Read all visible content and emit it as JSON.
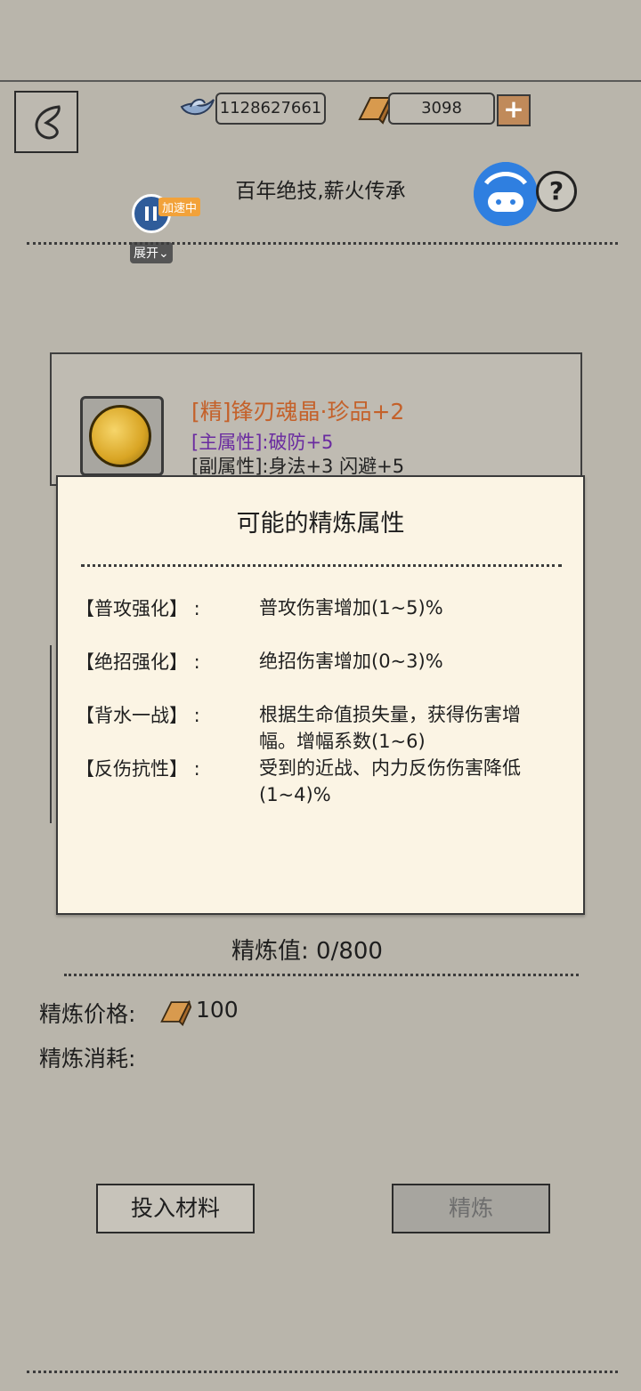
{
  "header": {
    "silver_amount": "1128627661",
    "gold_amount": "3098",
    "title": "百年绝技,薪火传承"
  },
  "overlay": {
    "accelerating_label": "加速中",
    "expand_label": "展开"
  },
  "item": {
    "name": "[精]锋刃魂晶·珍品+2",
    "main_attr": "[主属性]:破防+5",
    "sub_attr": "[副属性]:身法+3 闪避+5"
  },
  "popup": {
    "title": "可能的精炼属性",
    "attributes": [
      {
        "key": "【普攻强化】 :",
        "desc": "普攻伤害增加(1~5)%"
      },
      {
        "key": "【绝招强化】 :",
        "desc": "绝招伤害增加(0~3)%"
      },
      {
        "key": "【背水一战】 :",
        "desc": "根据生命值损失量，获得伤害增幅。增幅系数(1~6)"
      },
      {
        "key": "【反伤抗性】 :",
        "desc": "受到的近战、内力反伤伤害降低(1~4)%"
      }
    ]
  },
  "refine": {
    "value_label": "精炼值: 0/800",
    "price_label": "精炼价格:",
    "price_value": "100",
    "cost_label": "精炼消耗:"
  },
  "buttons": {
    "input_material": "投入材料",
    "refine": "精炼"
  },
  "colors": {
    "background": "#b9b5ab",
    "popup_bg": "#fbf4e4",
    "item_name": "#c4612a",
    "main_attr": "#6a2ba0",
    "plus_button": "#c08a5a"
  },
  "icons": [
    "back-icon",
    "silver-ingot-icon",
    "gold-bar-icon",
    "plus-icon",
    "help-icon",
    "gem-icon",
    "app-icon",
    "pause-icon"
  ]
}
